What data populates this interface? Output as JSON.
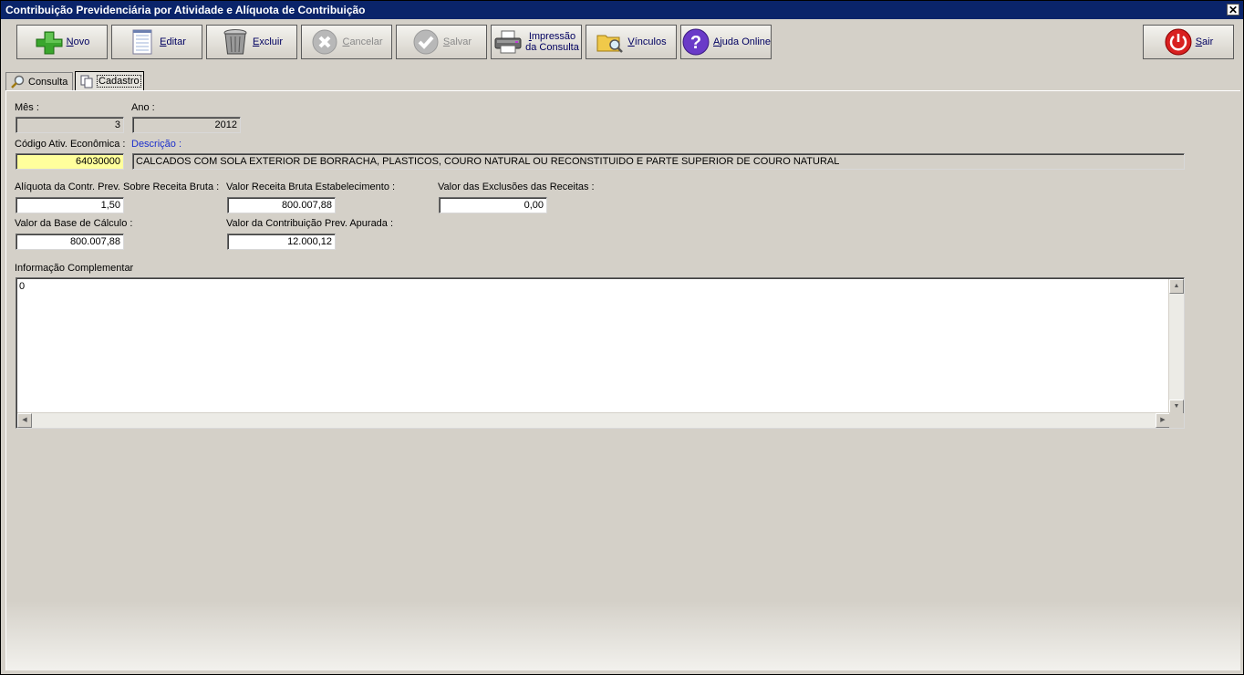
{
  "window": {
    "title": "Contribuição Previdenciária por Atividade e Alíquota de Contribuição",
    "close_glyph": "✕"
  },
  "toolbar": {
    "novo": "Novo",
    "editar": "Editar",
    "excluir": "Excluir",
    "cancelar": "Cancelar",
    "salvar": "Salvar",
    "impressao_line1": "Impressão",
    "impressao_line2": "da Consulta",
    "vinculos": "Vínculos",
    "ajuda": "Ajuda Online",
    "sair": "Sair"
  },
  "tabs": [
    {
      "label": "Consulta",
      "icon": "magnifier-icon"
    },
    {
      "label": "Cadastro",
      "icon": "copy-document-icon"
    }
  ],
  "form": {
    "mes_label": "Mês :",
    "mes_value": "3",
    "ano_label": "Ano :",
    "ano_value": "2012",
    "codigo_label": "Código Ativ. Econômica :",
    "codigo_value": "64030000",
    "descricao_label": "Descrição :",
    "descricao_value": "CALCADOS COM SOLA EXTERIOR DE BORRACHA, PLASTICOS, COURO NATURAL OU RECONSTITUIDO E PARTE SUPERIOR DE COURO NATURAL",
    "aliquota_label": "Alíquota da Contr. Prev. Sobre Receita Bruta :",
    "aliquota_value": "1,50",
    "receita_label": "Valor Receita Bruta Estabelecimento :",
    "receita_value": "800.007,88",
    "exclusoes_label": "Valor das Exclusões das Receitas :",
    "exclusoes_value": "0,00",
    "base_label": "Valor da Base de Cálculo :",
    "base_value": "800.007,88",
    "contribuicao_label": "Valor da Contribuição Prev. Apurada :",
    "contribuicao_value": "12.000,12",
    "info_label": "Informação Complementar",
    "info_value": "0"
  },
  "colors": {
    "titlebar": "#0a246a",
    "face": "#d4d0c8",
    "highlight_field": "#ffff9c",
    "link_label": "#1b2fcc"
  }
}
